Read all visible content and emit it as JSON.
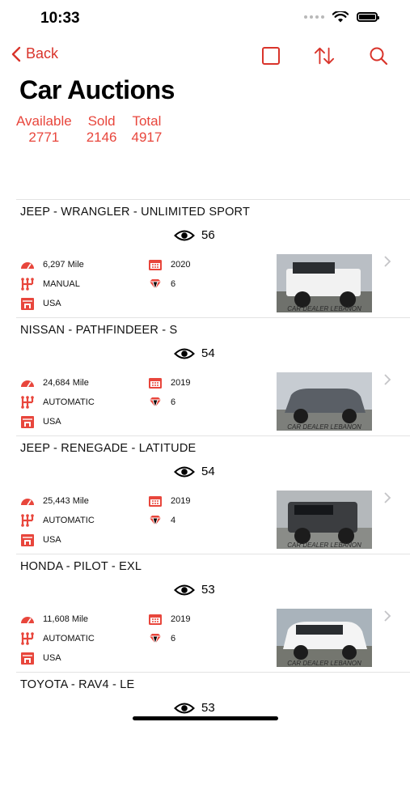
{
  "status_bar": {
    "time": "10:33"
  },
  "nav": {
    "back_label": "Back"
  },
  "page": {
    "title": "Car Auctions"
  },
  "stats": [
    {
      "label": "Available",
      "value": "2771"
    },
    {
      "label": "Sold",
      "value": "2146"
    },
    {
      "label": "Total",
      "value": "4917"
    }
  ],
  "colors": {
    "accent": "#d9342b",
    "stat": "#e8463c"
  },
  "icons": {
    "mileage": "speedometer-icon",
    "transmission": "gearbox-icon",
    "origin": "shop-icon",
    "year": "calendar-icon",
    "cylinders": "engine-icon",
    "views": "eye-icon"
  },
  "cars": [
    {
      "title": "JEEP - WRANGLER - UNLIMITED SPORT",
      "views": "56",
      "mileage": "6,297 Mile",
      "year": "2020",
      "transmission": "MANUAL",
      "cylinders": "6",
      "origin": "USA",
      "watermark": "CAR DEALER LEBANON",
      "body_color": "#f2f2f2"
    },
    {
      "title": "NISSAN - PATHFINDEER - S",
      "views": "54",
      "mileage": "24,684 Mile",
      "year": "2019",
      "transmission": "AUTOMATIC",
      "cylinders": "6",
      "origin": "USA",
      "watermark": "CAR DEALER LEBANON",
      "body_color": "#5a5f66"
    },
    {
      "title": "JEEP - RENEGADE - LATITUDE",
      "views": "54",
      "mileage": "25,443 Mile",
      "year": "2019",
      "transmission": "AUTOMATIC",
      "cylinders": "4",
      "origin": "USA",
      "watermark": "CAR DEALER LEBANON",
      "body_color": "#3b3d40"
    },
    {
      "title": "HONDA - PILOT - EXL",
      "views": "53",
      "mileage": "11,608 Mile",
      "year": "2019",
      "transmission": "AUTOMATIC",
      "cylinders": "6",
      "origin": "USA",
      "watermark": "CAR DEALER LEBANON",
      "body_color": "#f4f4f4"
    },
    {
      "title": "TOYOTA - RAV4 - LE",
      "views": "53"
    }
  ]
}
